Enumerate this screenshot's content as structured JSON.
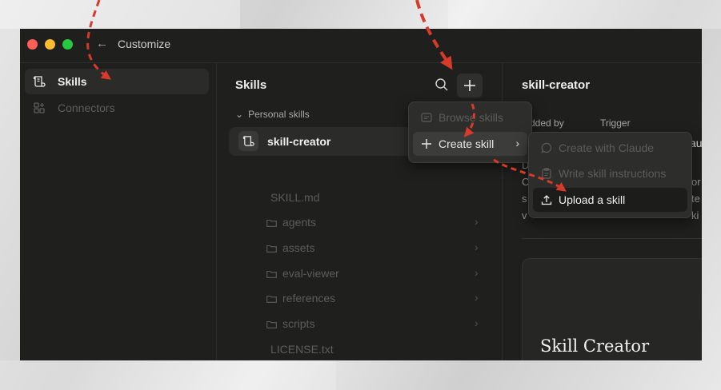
{
  "window": {
    "title": "Customize"
  },
  "sidebar": {
    "items": [
      {
        "label": "Skills",
        "active": true
      },
      {
        "label": "Connectors",
        "active": false
      }
    ]
  },
  "skills_panel": {
    "title": "Skills",
    "section_label": "Personal skills",
    "selected_skill": "skill-creator",
    "tree": [
      {
        "label": "SKILL.md",
        "type": "file"
      },
      {
        "label": "agents",
        "type": "folder"
      },
      {
        "label": "assets",
        "type": "folder"
      },
      {
        "label": "eval-viewer",
        "type": "folder"
      },
      {
        "label": "references",
        "type": "folder"
      },
      {
        "label": "scripts",
        "type": "folder"
      },
      {
        "label": "LICENSE.txt",
        "type": "file"
      }
    ]
  },
  "detail_panel": {
    "title": "skill-creator",
    "added_by_label": "dded by",
    "trigger_label": "Trigger",
    "fragments": [
      "au",
      "D",
      "C",
      "or",
      "s",
      "te",
      "v",
      "",
      "ki"
    ],
    "card_title": "Skill Creator"
  },
  "add_menu": {
    "items": [
      {
        "label": "Browse skills",
        "disabled": true
      },
      {
        "label": "Create skill",
        "disabled": false
      }
    ]
  },
  "create_submenu": {
    "items": [
      {
        "label": "Create with Claude",
        "disabled": true
      },
      {
        "label": "Write skill instructions",
        "disabled": true
      },
      {
        "label": "Upload a skill",
        "disabled": false
      }
    ]
  },
  "colors": {
    "window_bg": "#1f1f1e",
    "annotation_arrow": "#d63a2a",
    "traffic_red": "#ff5f57",
    "traffic_yellow": "#febc2e",
    "traffic_green": "#28c840"
  }
}
